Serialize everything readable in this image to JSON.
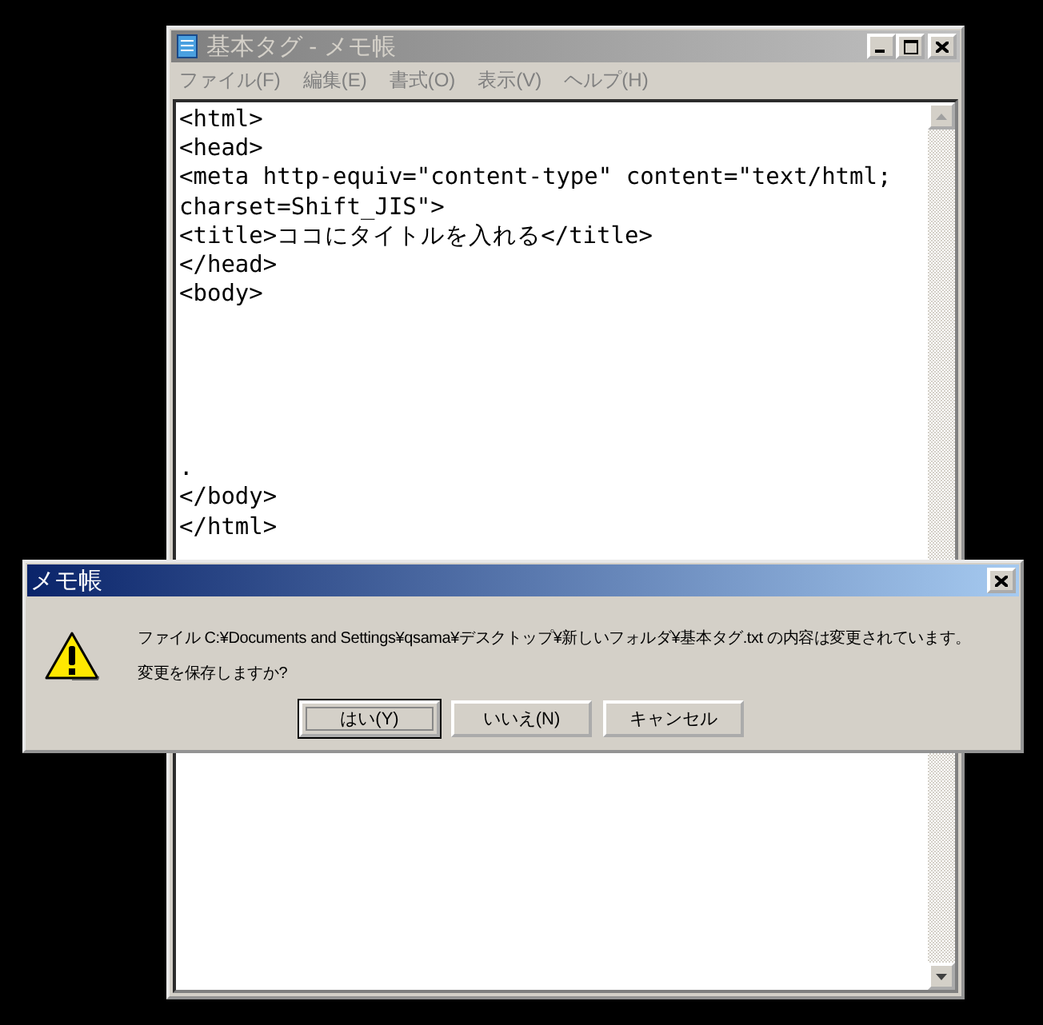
{
  "window": {
    "title": "基本タグ - メモ帳",
    "active": false
  },
  "menu": [
    "ファイル(F)",
    "編集(E)",
    "書式(O)",
    "表示(V)",
    "ヘルプ(H)"
  ],
  "editor": {
    "lines": [
      {
        "kind": "text",
        "text": "<html>"
      },
      {
        "kind": "text",
        "text": "<head>"
      },
      {
        "kind": "text",
        "text": "<meta http-equiv=\"content-type\" content=\"text/html;"
      },
      {
        "kind": "text",
        "text": "charset=Shift_JIS\">"
      },
      {
        "kind": "text",
        "text": "<title>ココにタイトルを入れる</title>"
      },
      {
        "kind": "text",
        "text": "</head>"
      },
      {
        "kind": "text",
        "text": "<body>"
      },
      {
        "kind": "blank"
      },
      {
        "kind": "blank"
      },
      {
        "kind": "blank"
      },
      {
        "kind": "blank"
      },
      {
        "kind": "blank"
      },
      {
        "kind": "text",
        "text": "."
      },
      {
        "kind": "text",
        "text": "</body>"
      },
      {
        "kind": "text",
        "text": "</html>"
      }
    ]
  },
  "dialog": {
    "title": "メモ帳",
    "active": true,
    "message": [
      "ファイル C:¥Documents and Settings¥qsama¥デスクトップ¥新しいフォルダ¥基本タグ.txt の内容は変更されています。",
      "変更を保存しますか?"
    ],
    "buttons": [
      {
        "label": "はい(Y)",
        "selected": true
      },
      {
        "label": "いいえ(N)",
        "selected": false
      },
      {
        "label": "キャンセル",
        "selected": false
      }
    ]
  }
}
